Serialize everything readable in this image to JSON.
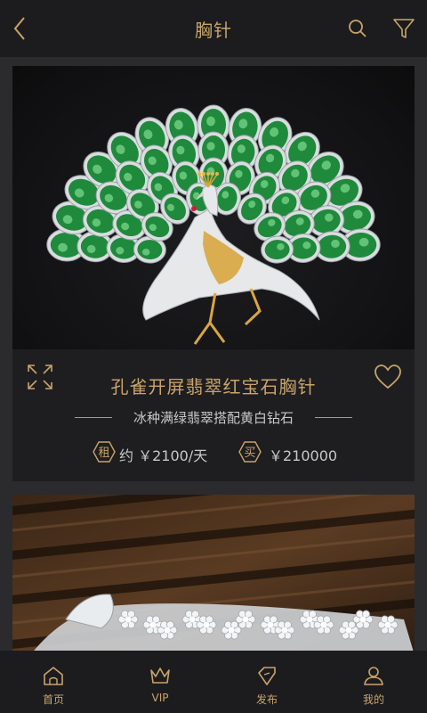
{
  "header": {
    "title": "胸针",
    "back_icon": "chevron-left-icon",
    "search_icon": "search-icon",
    "filter_icon": "filter-icon"
  },
  "colors": {
    "accent_gold": "#c9a46b",
    "header_bg": "#1c1c1e",
    "card_bg": "#1e1e20",
    "page_bg": "#2b2b2d"
  },
  "products": [
    {
      "name": "孔雀开屏翡翠红宝石胸针",
      "subtitle": "冰种满绿翡翠搭配黄白钻石",
      "rent_badge": "租",
      "rent_price": "约 ￥2100/天",
      "buy_badge": "买",
      "buy_price": "￥210000"
    }
  ],
  "bottom_nav": [
    {
      "label": "首页",
      "icon": "home-icon"
    },
    {
      "label": "VIP",
      "icon": "crown-icon"
    },
    {
      "label": "发布",
      "icon": "tag-icon"
    },
    {
      "label": "我的",
      "icon": "user-icon"
    }
  ]
}
